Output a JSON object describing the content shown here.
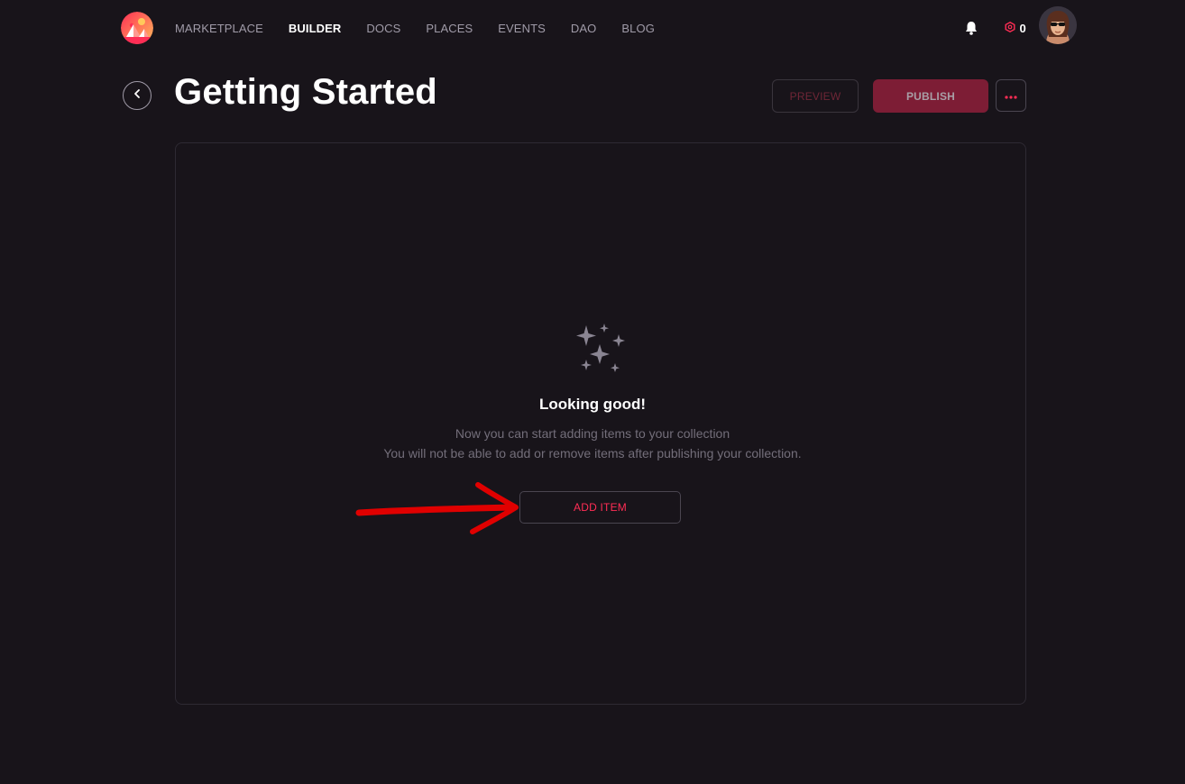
{
  "nav": {
    "items": [
      {
        "label": "MARKETPLACE",
        "active": false
      },
      {
        "label": "BUILDER",
        "active": true
      },
      {
        "label": "DOCS",
        "active": false
      },
      {
        "label": "PLACES",
        "active": false
      },
      {
        "label": "EVENTS",
        "active": false
      },
      {
        "label": "DAO",
        "active": false
      },
      {
        "label": "BLOG",
        "active": false
      }
    ]
  },
  "toolbar": {
    "mana_balance": "0",
    "land_balance": "0"
  },
  "header": {
    "title": "Getting Started",
    "preview_label": "PREVIEW",
    "publish_label": "PUBLISH",
    "more_label": "•••"
  },
  "empty_state": {
    "title": "Looking good!",
    "line1": "Now you can start adding items to your collection",
    "line2": "You will not be able to add or remove items after publishing your collection.",
    "add_item_label": "ADD ITEM"
  },
  "colors": {
    "background": "#18141a",
    "accent": "#ff2d55",
    "publish_bg": "#7d1d35",
    "annotation_arrow": "#e00000"
  },
  "icons": [
    "decentraland-logo-icon",
    "bell-icon",
    "mana-icon",
    "land-icon",
    "avatar-image",
    "back-chevron-icon",
    "sparkles-icon",
    "annotation-arrow"
  ]
}
